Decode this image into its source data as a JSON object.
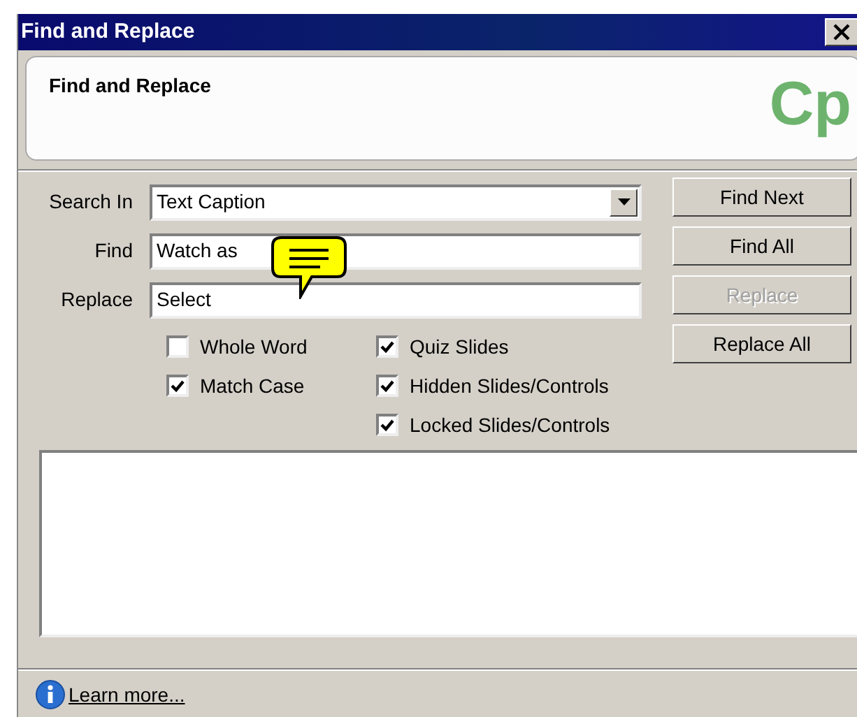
{
  "window": {
    "title": "Find and Replace"
  },
  "header": {
    "title": "Find and Replace",
    "logo": "Cp"
  },
  "fields": [
    {
      "kind": "combo",
      "label": "Search In",
      "value": "Text Caption"
    },
    {
      "kind": "text",
      "label": "Find",
      "value": "Watch as"
    },
    {
      "kind": "text",
      "label": "Replace",
      "value": "Select"
    }
  ],
  "options_left": [
    {
      "label": "Whole Word",
      "checked": false
    },
    {
      "label": "Match Case",
      "checked": true
    }
  ],
  "options_right": [
    {
      "label": "Quiz Slides",
      "checked": true
    },
    {
      "label": "Hidden Slides/Controls",
      "checked": true
    },
    {
      "label": "Locked Slides/Controls",
      "checked": true
    }
  ],
  "buttons": [
    {
      "label": "Find Next",
      "disabled": false
    },
    {
      "label": "Find All",
      "disabled": false
    },
    {
      "label": "Replace",
      "disabled": true
    },
    {
      "label": "Replace All",
      "disabled": false
    }
  ],
  "footer": {
    "link": "Learn more..."
  }
}
